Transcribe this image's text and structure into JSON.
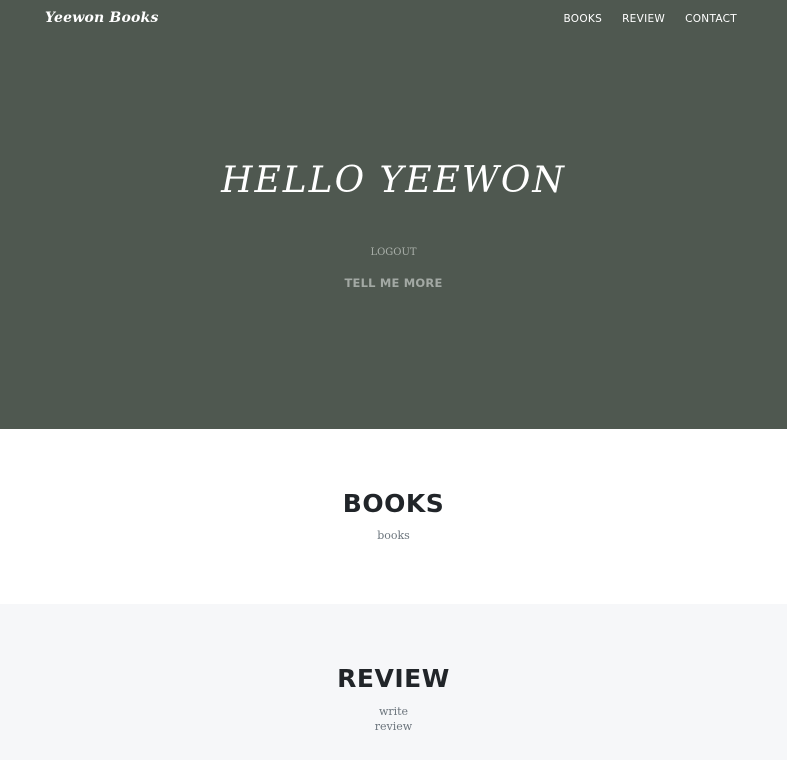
{
  "navbar": {
    "brand": "Yeewon Books",
    "links": [
      {
        "label": "BOOKS"
      },
      {
        "label": "REVIEW"
      },
      {
        "label": "CONTACT"
      }
    ]
  },
  "hero": {
    "title": "HELLO YEEWON",
    "logout_label": "LOGOUT",
    "cta_label": "TELL ME MORE",
    "background_color": "#4f5850"
  },
  "books_section": {
    "title": "BOOKS",
    "link_label": "books"
  },
  "review_section": {
    "title": "REVIEW",
    "links": [
      {
        "label": "write"
      },
      {
        "label": "review"
      }
    ],
    "background_color": "#f6f7f9"
  }
}
